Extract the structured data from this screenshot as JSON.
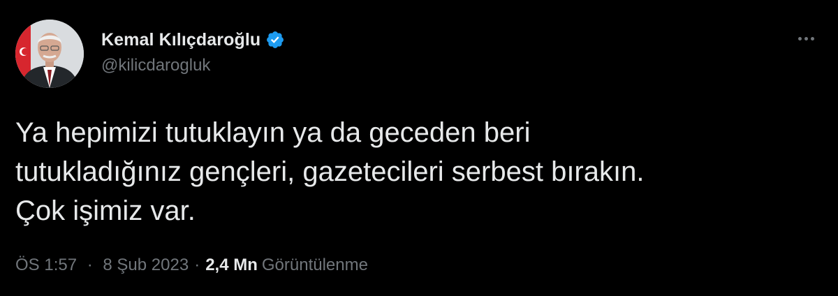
{
  "author": {
    "display_name": "Kemal Kılıçdaroğlu",
    "handle": "@kilicdarogluk",
    "verified": true,
    "avatar_icon": "profile-photo",
    "verified_icon": "verified-badge-icon"
  },
  "more_icon": "more-options-icon",
  "tweet": {
    "lines": [
      "Ya hepimizi tutuklayın ya da geceden beri",
      "tutukladığınız gençleri, gazetecileri serbest bırakın.",
      "Çok işimiz var."
    ]
  },
  "meta": {
    "time": "ÖS 1:57",
    "separator": "·",
    "date": "8 Şub 2023",
    "views_count": "2,4 Mn",
    "views_label": "Görüntülenme"
  },
  "colors": {
    "background": "#000000",
    "primary_text": "#e7e9ea",
    "secondary_text": "#71767b",
    "verified_blue": "#1d9bf0"
  }
}
